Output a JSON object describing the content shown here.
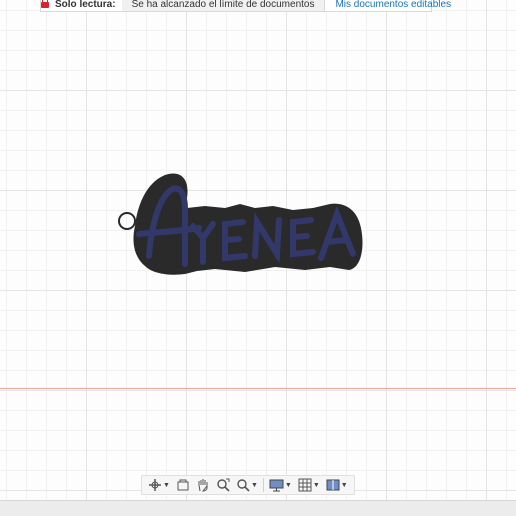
{
  "banner": {
    "read_only_label": "Solo lectura:",
    "message": "Se ha alcanzado el límite de documentos",
    "link": "Mis documentos editables"
  },
  "model": {
    "text": "AYENEA",
    "fill_color": "#33386b",
    "base_color": "#2a2a2a"
  },
  "navbar": {
    "icons": [
      "orbit-icon",
      "fit-icon",
      "pan-icon",
      "zoom-window-icon",
      "zoom-icon",
      "display-icon",
      "grid-icon",
      "viewports-icon"
    ]
  }
}
